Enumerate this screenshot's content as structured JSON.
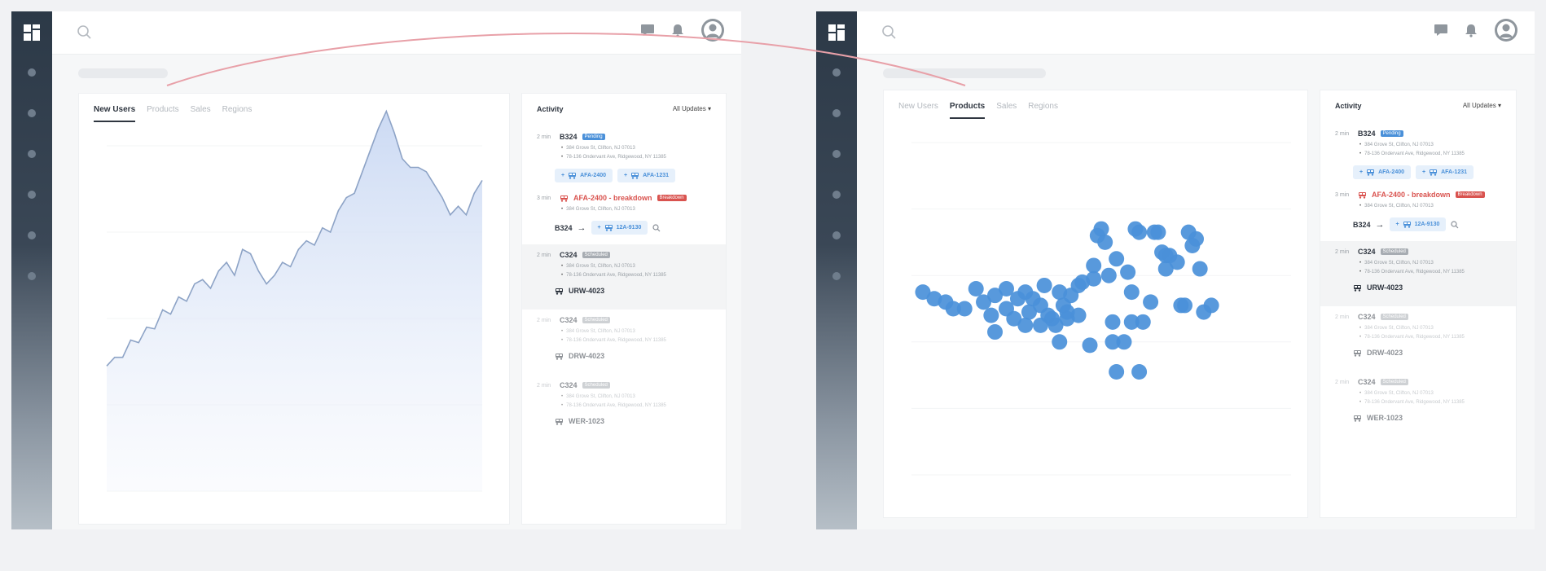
{
  "screens": [
    {
      "tabs": [
        "New Users",
        "Products",
        "Sales",
        "Regions"
      ],
      "active_tab": 0,
      "chart_data": {
        "type": "area",
        "x_ticks": [
          "",
          "",
          "",
          "",
          ""
        ],
        "y_ticks": [
          "",
          "",
          "",
          "",
          ""
        ],
        "y_range": [
          0,
          400
        ],
        "values": [
          145,
          155,
          155,
          175,
          172,
          190,
          188,
          210,
          205,
          225,
          220,
          240,
          245,
          235,
          255,
          265,
          250,
          280,
          275,
          255,
          240,
          250,
          265,
          260,
          280,
          290,
          285,
          305,
          300,
          325,
          340,
          345,
          370,
          395,
          420,
          440,
          415,
          385,
          375,
          375,
          370,
          355,
          340,
          320,
          330,
          320,
          345,
          360
        ]
      },
      "activity": {
        "title": "Activity",
        "filter": "All Updates"
      }
    },
    {
      "tabs": [
        "New Users",
        "Products",
        "Sales",
        "Regions"
      ],
      "active_tab": 1,
      "chart_data": {
        "type": "scatter",
        "x_ticks": [
          "",
          "",
          "",
          "",
          ""
        ],
        "y_ticks": [
          "",
          "",
          "",
          "",
          "",
          ""
        ],
        "x_range": [
          0,
          100
        ],
        "y_range": [
          0,
          100
        ],
        "points": [
          [
            3,
            55
          ],
          [
            6,
            53
          ],
          [
            9,
            52
          ],
          [
            11,
            50
          ],
          [
            14,
            50
          ],
          [
            17,
            56
          ],
          [
            19,
            52
          ],
          [
            21,
            48
          ],
          [
            22,
            43
          ],
          [
            22,
            54
          ],
          [
            25,
            56
          ],
          [
            25,
            50
          ],
          [
            27,
            47
          ],
          [
            28,
            53
          ],
          [
            30,
            55
          ],
          [
            30,
            45
          ],
          [
            31,
            49
          ],
          [
            32,
            53
          ],
          [
            34,
            51
          ],
          [
            34,
            45
          ],
          [
            35,
            57
          ],
          [
            36,
            48
          ],
          [
            37,
            47
          ],
          [
            38,
            45
          ],
          [
            39,
            55
          ],
          [
            39,
            40
          ],
          [
            40,
            51
          ],
          [
            41,
            49
          ],
          [
            41,
            47
          ],
          [
            42,
            54
          ],
          [
            44,
            57
          ],
          [
            44,
            48
          ],
          [
            45,
            58
          ],
          [
            47,
            39
          ],
          [
            48,
            63
          ],
          [
            48,
            59
          ],
          [
            49,
            72
          ],
          [
            50,
            74
          ],
          [
            51,
            70
          ],
          [
            52,
            60
          ],
          [
            53,
            46
          ],
          [
            53,
            40
          ],
          [
            54,
            65
          ],
          [
            54,
            31
          ],
          [
            56,
            40
          ],
          [
            57,
            61
          ],
          [
            58,
            55
          ],
          [
            58,
            46
          ],
          [
            59,
            74
          ],
          [
            60,
            73
          ],
          [
            60,
            31
          ],
          [
            61,
            46
          ],
          [
            63,
            52
          ],
          [
            64,
            73
          ],
          [
            65,
            73
          ],
          [
            66,
            67
          ],
          [
            67,
            66
          ],
          [
            67,
            62
          ],
          [
            68,
            66
          ],
          [
            70,
            64
          ],
          [
            71,
            51
          ],
          [
            72,
            51
          ],
          [
            73,
            73
          ],
          [
            74,
            69
          ],
          [
            75,
            71
          ],
          [
            76,
            62
          ],
          [
            77,
            49
          ],
          [
            79,
            51
          ]
        ]
      },
      "activity": {
        "title": "Activity",
        "filter": "All Updates"
      }
    }
  ],
  "activity_items": [
    {
      "time": "2 min",
      "id": "B324",
      "badge": "Pending",
      "badge_color": "blue",
      "addresses": [
        "384 Grove St, Clifton, NJ 07013",
        "78-136 Ondervant Ave, Ridgewood, NY 11385"
      ],
      "chips": [
        "AFA-2400",
        "AFA-1231"
      ]
    },
    {
      "time": "3 min",
      "id": "AFA-2400 - breakdown",
      "badge": "Breakdown",
      "badge_color": "red",
      "addresses": [
        "384 Grove St, Clifton, NJ 07013"
      ],
      "transfer_from": "B324",
      "transfer_to": "12A-9130"
    },
    {
      "time": "2 min",
      "id": "C324",
      "badge": "Scheduled",
      "badge_color": "grey",
      "addresses": [
        "384 Grove St, Clifton, NJ 07013",
        "78-136 Ondervant Ave, Ridgewood, NY 11385"
      ],
      "vehicle": "URW-4023"
    },
    {
      "time": "2 min",
      "id": "C324",
      "badge": "Scheduled",
      "badge_color": "grey",
      "addresses": [
        "384 Grove St, Clifton, NJ 07013",
        "78-136 Ondervant Ave, Ridgewood, NY 11385"
      ],
      "vehicle": "DRW-4023"
    },
    {
      "time": "2 min",
      "id": "C324",
      "badge": "Scheduled",
      "badge_color": "grey",
      "addresses": [
        "384 Grove St, Clifton, NJ 07013",
        "78-136 Ondervant Ave, Ridgewood, NY 11385"
      ],
      "vehicle": "WER-1023"
    }
  ],
  "colors": {
    "accent_blue": "#4a90d9",
    "alert_red": "#d9534f",
    "sidebar_dark": "#2c3947",
    "connector": "#e8a0a8"
  },
  "icons": [
    "dashboard-logo-icon",
    "search-icon",
    "chat-icon",
    "bell-icon",
    "user-avatar-icon",
    "truck-icon",
    "arrow-right-icon",
    "magnifier-icon"
  ]
}
